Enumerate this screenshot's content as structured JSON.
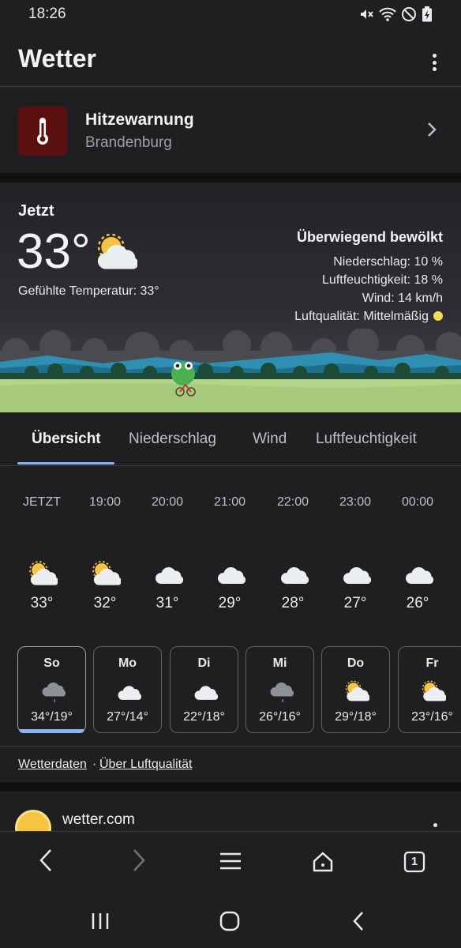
{
  "status_bar": {
    "time": "18:26",
    "icons": [
      "mute-icon",
      "wifi-icon",
      "do-not-disturb-icon",
      "battery-charging-icon"
    ]
  },
  "header": {
    "title": "Wetter",
    "menu_icon": "more-vert-icon"
  },
  "warning": {
    "title": "Hitzewarnung",
    "region": "Brandenburg",
    "icon": "thermometer-icon",
    "icon_bg": "#5b0f0f"
  },
  "current": {
    "label": "Jetzt",
    "temperature": "33°",
    "icon": "partly-cloudy-icon",
    "feels_like": "Gefühlte Temperatur: 33°",
    "condition": "Überwiegend bewölkt",
    "precipitation": "Niederschlag: 10 %",
    "humidity": "Luftfeuchtigkeit: 18 %",
    "wind": "Wind: 14 km/h",
    "air_quality": "Luftqualität: Mittelmäßig",
    "air_quality_color": "#f7dd55"
  },
  "tabs": [
    {
      "label": "Übersicht",
      "active": true
    },
    {
      "label": "Niederschlag",
      "active": false
    },
    {
      "label": "Wind",
      "active": false
    },
    {
      "label": "Luftfeuchtigkeit",
      "active": false
    }
  ],
  "hourly": [
    {
      "time": "JETZT",
      "icon": "partly-cloudy-icon",
      "temp": "33°"
    },
    {
      "time": "19:00",
      "icon": "partly-cloudy-icon",
      "temp": "32°"
    },
    {
      "time": "20:00",
      "icon": "cloudy-icon",
      "temp": "31°"
    },
    {
      "time": "21:00",
      "icon": "cloudy-icon",
      "temp": "29°"
    },
    {
      "time": "22:00",
      "icon": "cloudy-icon",
      "temp": "28°"
    },
    {
      "time": "23:00",
      "icon": "cloudy-icon",
      "temp": "27°"
    },
    {
      "time": "00:00",
      "icon": "cloudy-icon",
      "temp": "26°"
    }
  ],
  "daily": [
    {
      "day": "So",
      "icon": "rain-icon",
      "temps": "34°/19°",
      "selected": true
    },
    {
      "day": "Mo",
      "icon": "cloudy-icon",
      "temps": "27°/14°",
      "selected": false
    },
    {
      "day": "Di",
      "icon": "cloudy-icon",
      "temps": "22°/18°",
      "selected": false
    },
    {
      "day": "Mi",
      "icon": "rain-icon",
      "temps": "26°/16°",
      "selected": false
    },
    {
      "day": "Do",
      "icon": "partly-cloudy-icon",
      "temps": "29°/18°",
      "selected": false
    },
    {
      "day": "Fr",
      "icon": "partly-cloudy-icon",
      "temps": "23°/16°",
      "selected": false
    }
  ],
  "links": {
    "weather_data": "Wetterdaten",
    "separator": "·",
    "air_quality": "Über Luftqualität"
  },
  "source": {
    "name": "wetter.com",
    "logo": "sun-logo-icon"
  },
  "browser_bar": {
    "tab_count": "1"
  },
  "colors": {
    "accent": "#8ab4f8",
    "background": "#1f1f21",
    "divider": "#111112"
  }
}
